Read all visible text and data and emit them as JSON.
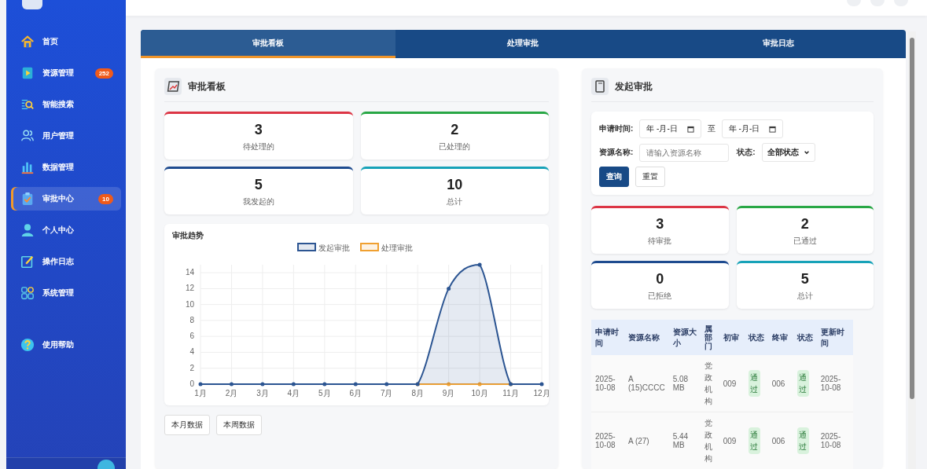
{
  "sidebar": {
    "items": [
      {
        "label": "首页",
        "selected": false
      },
      {
        "label": "资源管理",
        "badge": "252",
        "selected": false
      },
      {
        "label": "智能搜索",
        "selected": false
      },
      {
        "label": "用户管理",
        "selected": false
      },
      {
        "label": "数据管理",
        "selected": false
      },
      {
        "label": "审批中心",
        "badge": "10",
        "selected": true
      },
      {
        "label": "个人中心",
        "selected": false
      },
      {
        "label": "操作日志",
        "selected": false
      },
      {
        "label": "系统管理",
        "selected": false
      }
    ],
    "help": {
      "label": "使用帮助"
    }
  },
  "tabs": [
    {
      "label": "审批看板",
      "selected": true
    },
    {
      "label": "处理审批",
      "selected": false
    },
    {
      "label": "审批日志",
      "selected": false
    }
  ],
  "board": {
    "title": "审批看板",
    "stats": [
      {
        "value": "3",
        "label": "待处理的",
        "color": "#dc3545"
      },
      {
        "value": "2",
        "label": "已处理的",
        "color": "#28a745"
      },
      {
        "value": "5",
        "label": "我发起的",
        "color": "#1e4b8f"
      },
      {
        "value": "10",
        "label": "总计",
        "color": "#17a2b8"
      }
    ],
    "chart_title": "审批趋势",
    "chart_data": {
      "type": "line",
      "grid": true,
      "categories": [
        "1月",
        "2月",
        "3月",
        "4月",
        "5月",
        "6月",
        "7月",
        "8月",
        "9月",
        "10月",
        "11月",
        "12月"
      ],
      "series": [
        {
          "name": "发起审批",
          "color": "#2c5592",
          "values": [
            0,
            0,
            0,
            0,
            0,
            0,
            0,
            0,
            12,
            15,
            0,
            0
          ]
        },
        {
          "name": "处理审批",
          "color": "#f0a030",
          "values": [
            null,
            null,
            null,
            null,
            null,
            null,
            null,
            0,
            0,
            0,
            0,
            null
          ]
        }
      ],
      "legend": "top",
      "ylim": [
        0,
        15
      ],
      "yticks": [
        0,
        2,
        4,
        6,
        8,
        10,
        12,
        14
      ]
    },
    "buttons": [
      "本月数据",
      "本周数据"
    ]
  },
  "apply": {
    "title": "发起审批",
    "filters": {
      "time_label": "申请时间:",
      "date_from": "年 -月-日",
      "to": "至",
      "date_to": "年 -月-日",
      "name_label": "资源名称:",
      "name_placeholder": "请输入资源名称",
      "status_label": "状态:",
      "status_value": "全部状态",
      "search": "查询",
      "reset": "重置"
    },
    "stats": [
      {
        "value": "3",
        "label": "待审批",
        "color": "#dc3545"
      },
      {
        "value": "2",
        "label": "已通过",
        "color": "#28a745"
      },
      {
        "value": "0",
        "label": "已拒绝",
        "color": "#1e4b8f"
      },
      {
        "value": "5",
        "label": "总计",
        "color": "#17a2b8"
      }
    ],
    "table": {
      "columns": [
        {
          "label": "申请时间",
          "kind": "text"
        },
        {
          "label": "资源名称",
          "kind": "text"
        },
        {
          "label": "资源大小",
          "kind": "text"
        },
        {
          "label": "属部门",
          "kind": "vertical"
        },
        {
          "label": "初审",
          "kind": "text"
        },
        {
          "label": "状态",
          "kind": "badge"
        },
        {
          "label": "终审",
          "kind": "text"
        },
        {
          "label": "状态",
          "kind": "badge"
        },
        {
          "label": "更新时间",
          "kind": "text"
        }
      ],
      "rows": [
        [
          "2025-10-08",
          "A (15)CCCC",
          "5.08 MB",
          "党政机构",
          "009",
          "通过",
          "006",
          "通过",
          "2025-10-08"
        ],
        [
          "2025-10-08",
          "A (27)",
          "5.44 MB",
          "党政机构",
          "009",
          "通过",
          "006",
          "通过",
          "2025-10-08"
        ]
      ]
    }
  }
}
